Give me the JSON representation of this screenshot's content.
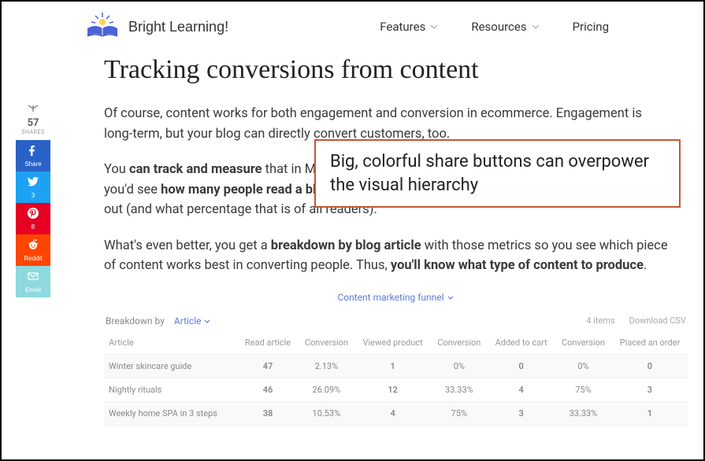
{
  "header": {
    "brand": "Bright Learning!",
    "nav": {
      "features": "Features",
      "resources": "Resources",
      "pricing": "Pricing"
    }
  },
  "page_title": "Tracking conversions from content",
  "share": {
    "count": "57",
    "label": "SHARES",
    "buttons": {
      "fb": "Share",
      "tw": "3",
      "pi": "8",
      "rd": "Reddit",
      "em": "Email"
    }
  },
  "content": {
    "p1": "Of course, content works for both engagement and conversion in ecommerce. Engagement is long-term, but your blog can directly convert customers, too.",
    "p2_a": "You ",
    "p2_b": "can track and measure",
    "p2_c": " that in Metrilo. In the funnel report for content we mentioned above, you'd see ",
    "p2_d": "how many people read a blog article",
    "p2_e": ", viewed a product as a result, carted and checked out (and what percentage that is of all readers).",
    "p3_a": "What's even better, you get a ",
    "p3_b": "breakdown by blog article",
    "p3_c": " with those metrics so you see which piece of content works best in converting people. Thus, ",
    "p3_d": "you'll know what type of content to produce",
    "p3_e": "."
  },
  "callout_text": "Big, colorful share buttons can overpower the visual hierarchy",
  "table": {
    "funnel_label": "Content marketing funnel",
    "breakdown_label": "Breakdown by",
    "breakdown_filter": "Article",
    "items_label": "4 items",
    "download_label": "Download CSV",
    "headers": [
      "Article",
      "Read article",
      "Conversion",
      "Viewed product",
      "Conversion",
      "Added to cart",
      "Conversion",
      "Placed an order"
    ],
    "rows": [
      {
        "article": "Winter skincare guide",
        "read": "47",
        "conv1": "2.13%",
        "viewed": "1",
        "conv2": "0%",
        "added": "0",
        "conv3": "0%",
        "placed": "0"
      },
      {
        "article": "Nightly rituals",
        "read": "46",
        "conv1": "26.09%",
        "viewed": "12",
        "conv2": "33.33%",
        "added": "4",
        "conv3": "75%",
        "placed": "3"
      },
      {
        "article": "Weekly home SPA in 3 steps",
        "read": "38",
        "conv1": "10.53%",
        "viewed": "4",
        "conv2": "75%",
        "added": "3",
        "conv3": "33.33%",
        "placed": "1"
      }
    ]
  }
}
